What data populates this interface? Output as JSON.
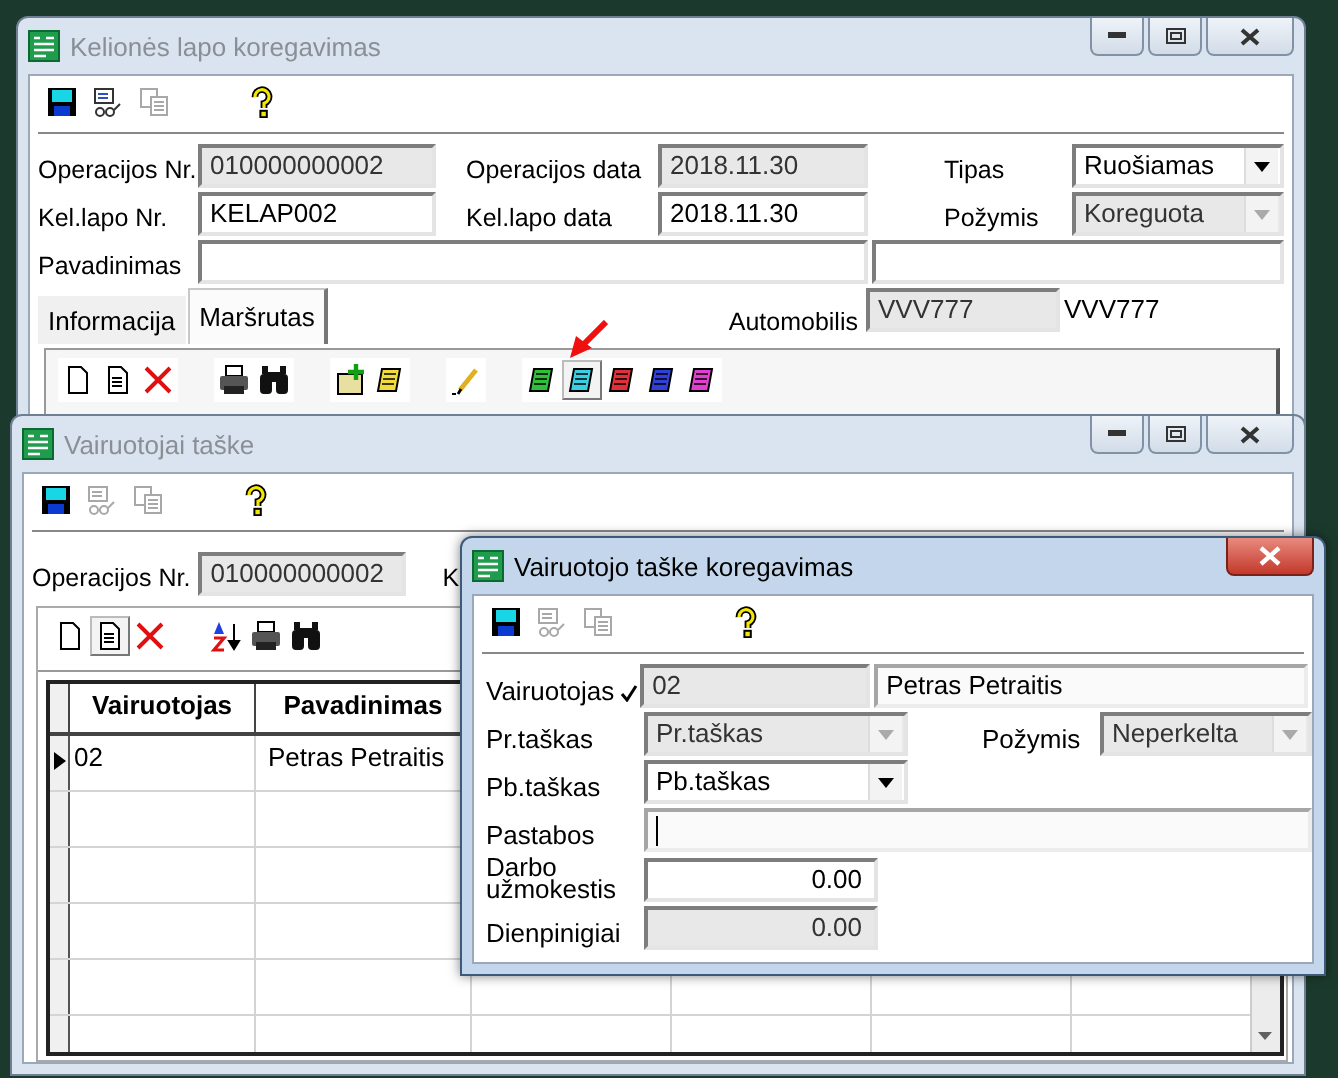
{
  "main_window": {
    "title": "Kelionės lapo koregavimas",
    "active": false,
    "toolbar": [
      [
        {
          "kind": "save",
          "disabled": false
        },
        {
          "kind": "preview",
          "disabled": false
        },
        {
          "kind": "copy",
          "disabled": true
        }
      ],
      [
        {
          "kind": "help",
          "disabled": false
        }
      ]
    ],
    "fields": [
      {
        "label": "Operacijos Nr.",
        "value": "010000000002",
        "disabled": true,
        "kind": "text"
      },
      {
        "label": "Operacijos data",
        "value": "2018.11.30",
        "disabled": true,
        "kind": "text"
      },
      {
        "label": "Tipas",
        "value": "Ruošiamas",
        "disabled": false,
        "kind": "combo"
      },
      {
        "label": "Kel.lapo Nr.",
        "value": "KELAP002",
        "disabled": false,
        "kind": "text"
      },
      {
        "label": "Kel.lapo data",
        "value": "2018.11.30",
        "disabled": false,
        "kind": "text"
      },
      {
        "label": "Požymis",
        "value": "Koreguota",
        "disabled": true,
        "kind": "combo"
      }
    ],
    "name_label": "Pavadinimas",
    "tabs": [
      {
        "label": "Informacija",
        "selected": false
      },
      {
        "label": "Maršrutas",
        "selected": true
      }
    ],
    "vehicle": {
      "label": "Automobilis",
      "value": "VVV777",
      "name": "VVV777"
    },
    "route_toolbar": [
      [
        {
          "kind": "new",
          "pressed": false
        },
        {
          "kind": "doc",
          "pressed": false
        },
        {
          "kind": "delete",
          "pressed": false
        }
      ],
      [
        {
          "kind": "print",
          "pressed": false
        },
        {
          "kind": "find",
          "pressed": false
        }
      ],
      [
        {
          "kind": "add",
          "pressed": false
        },
        {
          "kind": "note",
          "color": "#f2dc3c",
          "pressed": false
        }
      ],
      [
        {
          "kind": "pencil",
          "pressed": false
        }
      ],
      [
        {
          "kind": "note",
          "color": "#2fbf3a",
          "pressed": false
        },
        {
          "kind": "note",
          "color": "#3ad0e4",
          "pressed": true
        },
        {
          "kind": "note",
          "color": "#e0303a",
          "pressed": false
        },
        {
          "kind": "note",
          "color": "#3040d8",
          "pressed": false
        },
        {
          "kind": "note",
          "color": "#e040d0",
          "pressed": false
        }
      ]
    ]
  },
  "drivers_window": {
    "title": "Vairuotojai taške",
    "active": false,
    "toolbar": [
      [
        {
          "kind": "save",
          "disabled": false
        },
        {
          "kind": "preview",
          "disabled": true
        },
        {
          "kind": "copy",
          "disabled": true
        }
      ],
      [
        {
          "kind": "help",
          "disabled": false
        }
      ]
    ],
    "operation": {
      "label": "Operacijos Nr.",
      "value": "010000000002",
      "disabled": true
    },
    "cut_label": "K",
    "grid_toolbar": [
      [
        {
          "kind": "new",
          "pressed": false
        },
        {
          "kind": "doc",
          "pressed": true
        },
        {
          "kind": "delete",
          "pressed": false
        }
      ],
      [
        {
          "kind": "sort",
          "pressed": false
        },
        {
          "kind": "print",
          "pressed": false
        },
        {
          "kind": "find",
          "pressed": false
        }
      ]
    ],
    "columns": [
      "Vairuotojas",
      "Pavadinimas"
    ],
    "rows": [
      {
        "cells": [
          "02",
          "Petras Petraitis"
        ],
        "current": true
      }
    ]
  },
  "editor_window": {
    "title": "Vairuotojo taške koregavimas",
    "active": true,
    "toolbar": [
      [
        {
          "kind": "save",
          "disabled": false
        },
        {
          "kind": "preview",
          "disabled": true
        },
        {
          "kind": "copy",
          "disabled": true
        }
      ],
      [
        {
          "kind": "help",
          "disabled": false
        }
      ]
    ],
    "driver": {
      "label": "Vairuotojas",
      "verified": true,
      "code": "02",
      "name": "Petras Petraitis"
    },
    "start_point": {
      "label": "Pr.taškas",
      "value": "Pr.taškas",
      "disabled": true
    },
    "status": {
      "label": "Požymis",
      "value": "Neperkelta",
      "disabled": true
    },
    "end_point": {
      "label": "Pb.taškas",
      "value": "Pb.taškas",
      "disabled": false
    },
    "notes": {
      "label": "Pastabos",
      "focused": true
    },
    "wage": {
      "label": "Darbo užmokestis",
      "value": "0.00",
      "disabled": false
    },
    "allowance": {
      "label": "Dienpinigiai",
      "value": "0.00",
      "disabled": true
    }
  }
}
